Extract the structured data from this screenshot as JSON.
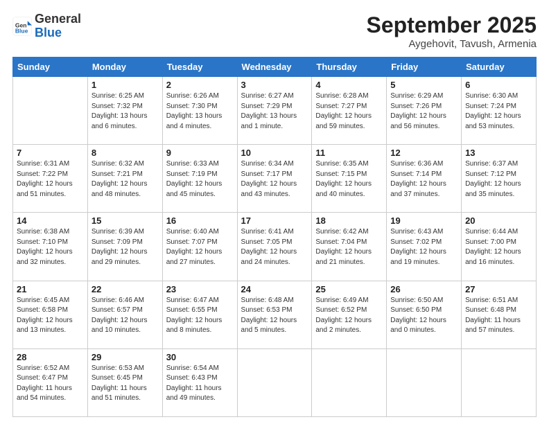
{
  "logo": {
    "general": "General",
    "blue": "Blue"
  },
  "header": {
    "title": "September 2025",
    "subtitle": "Aygehovit, Tavush, Armenia"
  },
  "days_of_week": [
    "Sunday",
    "Monday",
    "Tuesday",
    "Wednesday",
    "Thursday",
    "Friday",
    "Saturday"
  ],
  "weeks": [
    [
      {
        "day": "",
        "info": ""
      },
      {
        "day": "1",
        "info": "Sunrise: 6:25 AM\nSunset: 7:32 PM\nDaylight: 13 hours\nand 6 minutes."
      },
      {
        "day": "2",
        "info": "Sunrise: 6:26 AM\nSunset: 7:30 PM\nDaylight: 13 hours\nand 4 minutes."
      },
      {
        "day": "3",
        "info": "Sunrise: 6:27 AM\nSunset: 7:29 PM\nDaylight: 13 hours\nand 1 minute."
      },
      {
        "day": "4",
        "info": "Sunrise: 6:28 AM\nSunset: 7:27 PM\nDaylight: 12 hours\nand 59 minutes."
      },
      {
        "day": "5",
        "info": "Sunrise: 6:29 AM\nSunset: 7:26 PM\nDaylight: 12 hours\nand 56 minutes."
      },
      {
        "day": "6",
        "info": "Sunrise: 6:30 AM\nSunset: 7:24 PM\nDaylight: 12 hours\nand 53 minutes."
      }
    ],
    [
      {
        "day": "7",
        "info": "Sunrise: 6:31 AM\nSunset: 7:22 PM\nDaylight: 12 hours\nand 51 minutes."
      },
      {
        "day": "8",
        "info": "Sunrise: 6:32 AM\nSunset: 7:21 PM\nDaylight: 12 hours\nand 48 minutes."
      },
      {
        "day": "9",
        "info": "Sunrise: 6:33 AM\nSunset: 7:19 PM\nDaylight: 12 hours\nand 45 minutes."
      },
      {
        "day": "10",
        "info": "Sunrise: 6:34 AM\nSunset: 7:17 PM\nDaylight: 12 hours\nand 43 minutes."
      },
      {
        "day": "11",
        "info": "Sunrise: 6:35 AM\nSunset: 7:15 PM\nDaylight: 12 hours\nand 40 minutes."
      },
      {
        "day": "12",
        "info": "Sunrise: 6:36 AM\nSunset: 7:14 PM\nDaylight: 12 hours\nand 37 minutes."
      },
      {
        "day": "13",
        "info": "Sunrise: 6:37 AM\nSunset: 7:12 PM\nDaylight: 12 hours\nand 35 minutes."
      }
    ],
    [
      {
        "day": "14",
        "info": "Sunrise: 6:38 AM\nSunset: 7:10 PM\nDaylight: 12 hours\nand 32 minutes."
      },
      {
        "day": "15",
        "info": "Sunrise: 6:39 AM\nSunset: 7:09 PM\nDaylight: 12 hours\nand 29 minutes."
      },
      {
        "day": "16",
        "info": "Sunrise: 6:40 AM\nSunset: 7:07 PM\nDaylight: 12 hours\nand 27 minutes."
      },
      {
        "day": "17",
        "info": "Sunrise: 6:41 AM\nSunset: 7:05 PM\nDaylight: 12 hours\nand 24 minutes."
      },
      {
        "day": "18",
        "info": "Sunrise: 6:42 AM\nSunset: 7:04 PM\nDaylight: 12 hours\nand 21 minutes."
      },
      {
        "day": "19",
        "info": "Sunrise: 6:43 AM\nSunset: 7:02 PM\nDaylight: 12 hours\nand 19 minutes."
      },
      {
        "day": "20",
        "info": "Sunrise: 6:44 AM\nSunset: 7:00 PM\nDaylight: 12 hours\nand 16 minutes."
      }
    ],
    [
      {
        "day": "21",
        "info": "Sunrise: 6:45 AM\nSunset: 6:58 PM\nDaylight: 12 hours\nand 13 minutes."
      },
      {
        "day": "22",
        "info": "Sunrise: 6:46 AM\nSunset: 6:57 PM\nDaylight: 12 hours\nand 10 minutes."
      },
      {
        "day": "23",
        "info": "Sunrise: 6:47 AM\nSunset: 6:55 PM\nDaylight: 12 hours\nand 8 minutes."
      },
      {
        "day": "24",
        "info": "Sunrise: 6:48 AM\nSunset: 6:53 PM\nDaylight: 12 hours\nand 5 minutes."
      },
      {
        "day": "25",
        "info": "Sunrise: 6:49 AM\nSunset: 6:52 PM\nDaylight: 12 hours\nand 2 minutes."
      },
      {
        "day": "26",
        "info": "Sunrise: 6:50 AM\nSunset: 6:50 PM\nDaylight: 12 hours\nand 0 minutes."
      },
      {
        "day": "27",
        "info": "Sunrise: 6:51 AM\nSunset: 6:48 PM\nDaylight: 11 hours\nand 57 minutes."
      }
    ],
    [
      {
        "day": "28",
        "info": "Sunrise: 6:52 AM\nSunset: 6:47 PM\nDaylight: 11 hours\nand 54 minutes."
      },
      {
        "day": "29",
        "info": "Sunrise: 6:53 AM\nSunset: 6:45 PM\nDaylight: 11 hours\nand 51 minutes."
      },
      {
        "day": "30",
        "info": "Sunrise: 6:54 AM\nSunset: 6:43 PM\nDaylight: 11 hours\nand 49 minutes."
      },
      {
        "day": "",
        "info": ""
      },
      {
        "day": "",
        "info": ""
      },
      {
        "day": "",
        "info": ""
      },
      {
        "day": "",
        "info": ""
      }
    ]
  ]
}
